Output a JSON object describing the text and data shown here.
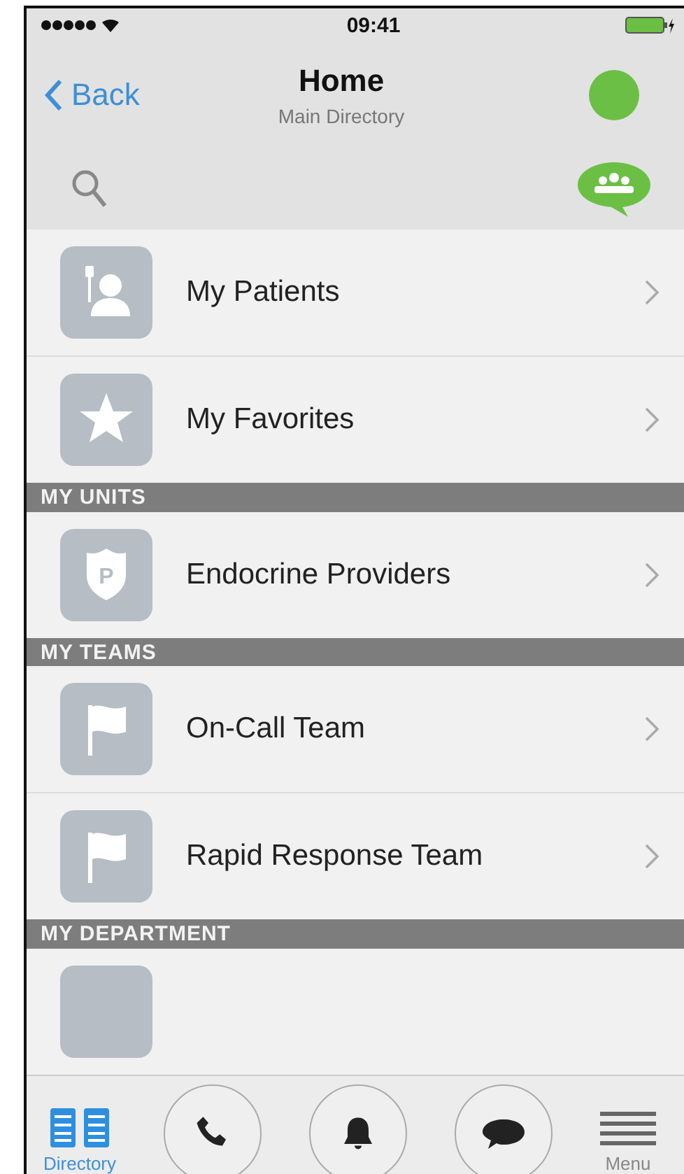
{
  "status_bar": {
    "time": "09:41"
  },
  "nav": {
    "back": "Back",
    "title": "Home",
    "subtitle": "Main Directory"
  },
  "sections": [
    {
      "items": [
        {
          "label": "My Patients",
          "kind": "patient"
        },
        {
          "label": "My Favorites",
          "kind": "star"
        }
      ]
    },
    {
      "header": "MY UNITS",
      "items": [
        {
          "label": "Endocrine Providers",
          "kind": "badge",
          "badge_letter": "P"
        }
      ]
    },
    {
      "header": "MY TEAMS",
      "items": [
        {
          "label": "On-Call Team",
          "kind": "flag"
        },
        {
          "label": "Rapid Response Team",
          "kind": "flag"
        }
      ]
    },
    {
      "header": "MY DEPARTMENT",
      "items": [
        {
          "kind": "blank"
        }
      ]
    }
  ],
  "tab_bar": [
    {
      "kind": "directory",
      "label": "Directory",
      "selected": true
    },
    {
      "kind": "phone",
      "selected": false
    },
    {
      "kind": "bell",
      "selected": false
    },
    {
      "kind": "chat",
      "selected": false
    },
    {
      "kind": "menu",
      "label": "Menu",
      "selected": false
    }
  ]
}
